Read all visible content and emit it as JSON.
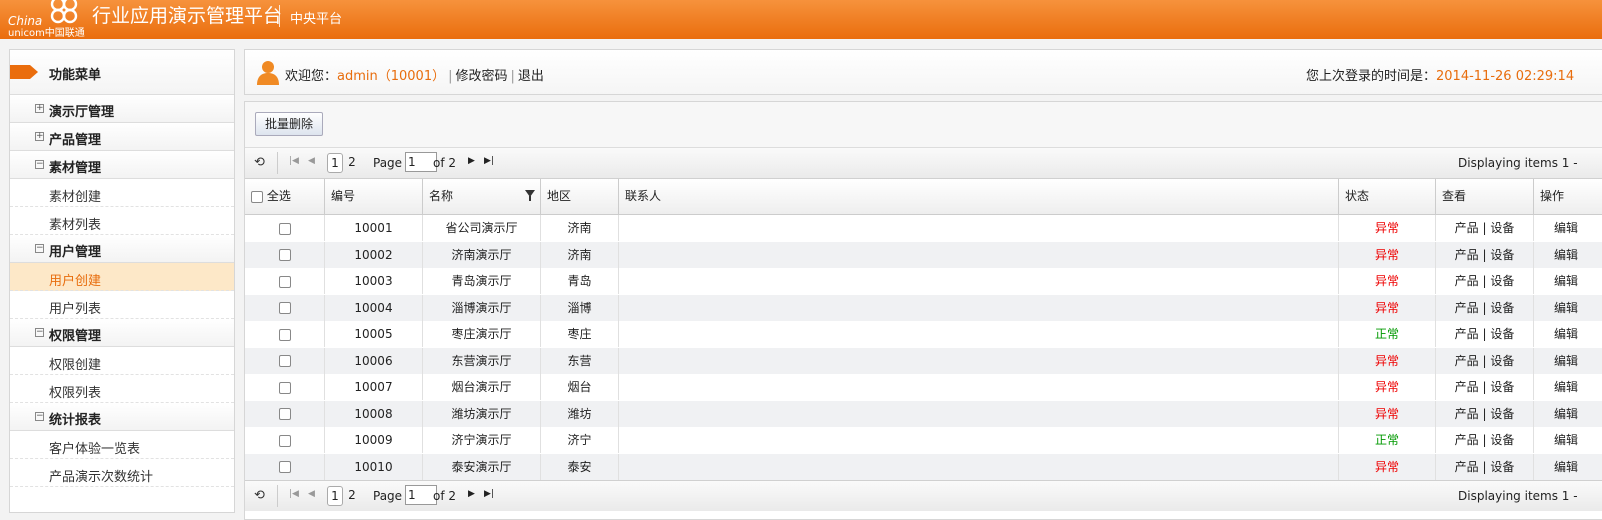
{
  "header": {
    "logo_line1": "China",
    "logo_line2": "unicom中国联通",
    "title": "行业应用演示管理平台",
    "subtitle": "中央平台"
  },
  "sidebar": {
    "heading": "功能菜单",
    "groups": [
      {
        "label": "演示厅管理",
        "expanded": false,
        "items": []
      },
      {
        "label": "产品管理",
        "expanded": false,
        "items": []
      },
      {
        "label": "素材管理",
        "expanded": true,
        "items": [
          "素材创建",
          "素材列表"
        ]
      },
      {
        "label": "用户管理",
        "expanded": true,
        "items": [
          "用户创建",
          "用户列表"
        ]
      },
      {
        "label": "权限管理",
        "expanded": true,
        "items": [
          "权限创建",
          "权限列表"
        ]
      },
      {
        "label": "统计报表",
        "expanded": true,
        "items": [
          "客户体验一览表",
          "产品演示次数统计"
        ]
      }
    ],
    "active_item": "用户创建"
  },
  "topbar": {
    "welcome": "欢迎您：",
    "user": "admin（10001）",
    "change_password": "修改密码",
    "logout": "退出",
    "last_login_label": "您上次登录的时间是：",
    "last_login_time": "2014-11-26 02:29:14"
  },
  "toolbar": {
    "batch_delete": "批量删除"
  },
  "pager": {
    "pages": [
      "1",
      "2"
    ],
    "current_page": "1",
    "page_word": "Page",
    "page_value": "1",
    "of_text": "of 2",
    "displaying": "Displaying items 1 -"
  },
  "table": {
    "columns": [
      "全选",
      "编号",
      "名称",
      "地区",
      "联系人",
      "状态",
      "查看",
      "操作"
    ],
    "rows": [
      {
        "id": "10001",
        "name": "省公司演示厅",
        "region": "济南",
        "contact": "",
        "status": "异常",
        "view": "产品 | 设备",
        "op": "编辑"
      },
      {
        "id": "10002",
        "name": "济南演示厅",
        "region": "济南",
        "contact": "",
        "status": "异常",
        "view": "产品 | 设备",
        "op": "编辑"
      },
      {
        "id": "10003",
        "name": "青岛演示厅",
        "region": "青岛",
        "contact": "",
        "status": "异常",
        "view": "产品 | 设备",
        "op": "编辑"
      },
      {
        "id": "10004",
        "name": "淄博演示厅",
        "region": "淄博",
        "contact": "",
        "status": "异常",
        "view": "产品 | 设备",
        "op": "编辑"
      },
      {
        "id": "10005",
        "name": "枣庄演示厅",
        "region": "枣庄",
        "contact": "",
        "status": "正常",
        "view": "产品 | 设备",
        "op": "编辑"
      },
      {
        "id": "10006",
        "name": "东营演示厅",
        "region": "东营",
        "contact": "",
        "status": "异常",
        "view": "产品 | 设备",
        "op": "编辑"
      },
      {
        "id": "10007",
        "name": "烟台演示厅",
        "region": "烟台",
        "contact": "",
        "status": "异常",
        "view": "产品 | 设备",
        "op": "编辑"
      },
      {
        "id": "10008",
        "name": "潍坊演示厅",
        "region": "潍坊",
        "contact": "",
        "status": "异常",
        "view": "产品 | 设备",
        "op": "编辑"
      },
      {
        "id": "10009",
        "name": "济宁演示厅",
        "region": "济宁",
        "contact": "",
        "status": "正常",
        "view": "产品 | 设备",
        "op": "编辑"
      },
      {
        "id": "10010",
        "name": "泰安演示厅",
        "region": "泰安",
        "contact": "",
        "status": "异常",
        "view": "产品 | 设备",
        "op": "编辑"
      }
    ]
  },
  "colors": {
    "brand": "#ea6d0d",
    "status_abnormal": "#ee0000",
    "status_normal": "#009900"
  }
}
